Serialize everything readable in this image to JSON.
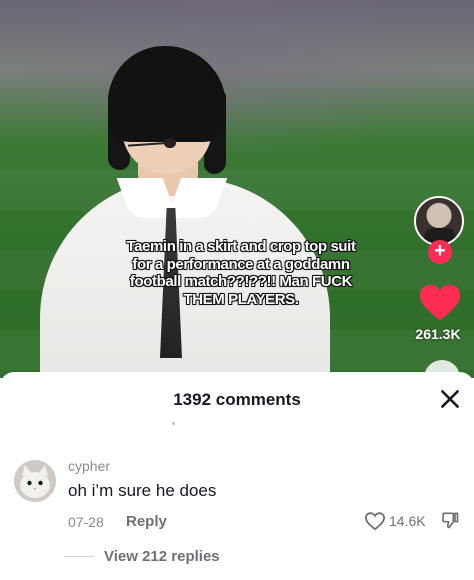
{
  "video": {
    "caption": "Taemin in a skirt and crop top suit for a performance at a goddamn football match??!??!! Man FUCK THEM PLAYERS.",
    "like_count": "261.3K",
    "follow_symbol": "+"
  },
  "comments_panel": {
    "title": "1392 comments",
    "close_symbol": "✕",
    "comments": [
      {
        "username": "cypher",
        "text": "oh i’m sure he does",
        "date": "07-28",
        "reply_label": "Reply",
        "likes": "14.6K",
        "view_replies": "View 212 replies"
      }
    ]
  },
  "colors": {
    "accent_red": "#fe2c55",
    "text_primary": "#161823",
    "text_secondary": "#8a8b91"
  },
  "icons": {
    "like": "heart-icon",
    "follow": "plus-icon",
    "close": "close-icon",
    "comment_like": "heart-outline-icon",
    "dislike": "thumbs-down-icon"
  }
}
